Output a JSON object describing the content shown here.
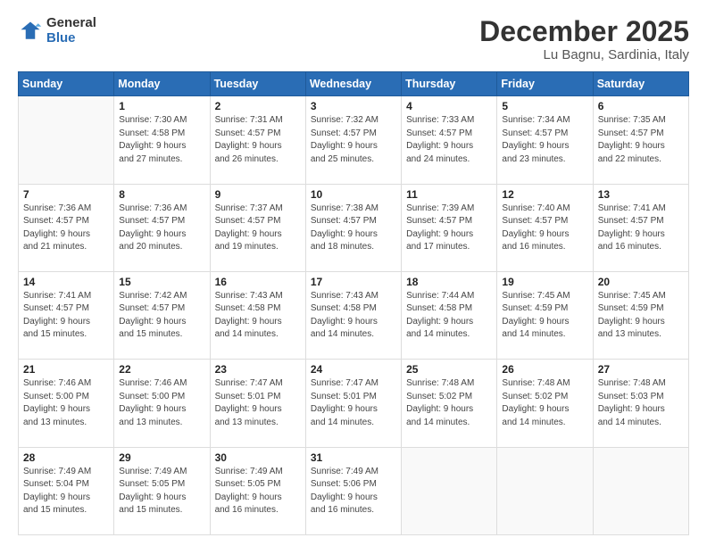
{
  "logo": {
    "general": "General",
    "blue": "Blue"
  },
  "header": {
    "title": "December 2025",
    "subtitle": "Lu Bagnu, Sardinia, Italy"
  },
  "weekdays": [
    "Sunday",
    "Monday",
    "Tuesday",
    "Wednesday",
    "Thursday",
    "Friday",
    "Saturday"
  ],
  "weeks": [
    [
      {
        "day": "",
        "info": ""
      },
      {
        "day": "1",
        "info": "Sunrise: 7:30 AM\nSunset: 4:58 PM\nDaylight: 9 hours\nand 27 minutes."
      },
      {
        "day": "2",
        "info": "Sunrise: 7:31 AM\nSunset: 4:57 PM\nDaylight: 9 hours\nand 26 minutes."
      },
      {
        "day": "3",
        "info": "Sunrise: 7:32 AM\nSunset: 4:57 PM\nDaylight: 9 hours\nand 25 minutes."
      },
      {
        "day": "4",
        "info": "Sunrise: 7:33 AM\nSunset: 4:57 PM\nDaylight: 9 hours\nand 24 minutes."
      },
      {
        "day": "5",
        "info": "Sunrise: 7:34 AM\nSunset: 4:57 PM\nDaylight: 9 hours\nand 23 minutes."
      },
      {
        "day": "6",
        "info": "Sunrise: 7:35 AM\nSunset: 4:57 PM\nDaylight: 9 hours\nand 22 minutes."
      }
    ],
    [
      {
        "day": "7",
        "info": "Sunrise: 7:36 AM\nSunset: 4:57 PM\nDaylight: 9 hours\nand 21 minutes."
      },
      {
        "day": "8",
        "info": "Sunrise: 7:36 AM\nSunset: 4:57 PM\nDaylight: 9 hours\nand 20 minutes."
      },
      {
        "day": "9",
        "info": "Sunrise: 7:37 AM\nSunset: 4:57 PM\nDaylight: 9 hours\nand 19 minutes."
      },
      {
        "day": "10",
        "info": "Sunrise: 7:38 AM\nSunset: 4:57 PM\nDaylight: 9 hours\nand 18 minutes."
      },
      {
        "day": "11",
        "info": "Sunrise: 7:39 AM\nSunset: 4:57 PM\nDaylight: 9 hours\nand 17 minutes."
      },
      {
        "day": "12",
        "info": "Sunrise: 7:40 AM\nSunset: 4:57 PM\nDaylight: 9 hours\nand 16 minutes."
      },
      {
        "day": "13",
        "info": "Sunrise: 7:41 AM\nSunset: 4:57 PM\nDaylight: 9 hours\nand 16 minutes."
      }
    ],
    [
      {
        "day": "14",
        "info": "Sunrise: 7:41 AM\nSunset: 4:57 PM\nDaylight: 9 hours\nand 15 minutes."
      },
      {
        "day": "15",
        "info": "Sunrise: 7:42 AM\nSunset: 4:57 PM\nDaylight: 9 hours\nand 15 minutes."
      },
      {
        "day": "16",
        "info": "Sunrise: 7:43 AM\nSunset: 4:58 PM\nDaylight: 9 hours\nand 14 minutes."
      },
      {
        "day": "17",
        "info": "Sunrise: 7:43 AM\nSunset: 4:58 PM\nDaylight: 9 hours\nand 14 minutes."
      },
      {
        "day": "18",
        "info": "Sunrise: 7:44 AM\nSunset: 4:58 PM\nDaylight: 9 hours\nand 14 minutes."
      },
      {
        "day": "19",
        "info": "Sunrise: 7:45 AM\nSunset: 4:59 PM\nDaylight: 9 hours\nand 14 minutes."
      },
      {
        "day": "20",
        "info": "Sunrise: 7:45 AM\nSunset: 4:59 PM\nDaylight: 9 hours\nand 13 minutes."
      }
    ],
    [
      {
        "day": "21",
        "info": "Sunrise: 7:46 AM\nSunset: 5:00 PM\nDaylight: 9 hours\nand 13 minutes."
      },
      {
        "day": "22",
        "info": "Sunrise: 7:46 AM\nSunset: 5:00 PM\nDaylight: 9 hours\nand 13 minutes."
      },
      {
        "day": "23",
        "info": "Sunrise: 7:47 AM\nSunset: 5:01 PM\nDaylight: 9 hours\nand 13 minutes."
      },
      {
        "day": "24",
        "info": "Sunrise: 7:47 AM\nSunset: 5:01 PM\nDaylight: 9 hours\nand 14 minutes."
      },
      {
        "day": "25",
        "info": "Sunrise: 7:48 AM\nSunset: 5:02 PM\nDaylight: 9 hours\nand 14 minutes."
      },
      {
        "day": "26",
        "info": "Sunrise: 7:48 AM\nSunset: 5:02 PM\nDaylight: 9 hours\nand 14 minutes."
      },
      {
        "day": "27",
        "info": "Sunrise: 7:48 AM\nSunset: 5:03 PM\nDaylight: 9 hours\nand 14 minutes."
      }
    ],
    [
      {
        "day": "28",
        "info": "Sunrise: 7:49 AM\nSunset: 5:04 PM\nDaylight: 9 hours\nand 15 minutes."
      },
      {
        "day": "29",
        "info": "Sunrise: 7:49 AM\nSunset: 5:05 PM\nDaylight: 9 hours\nand 15 minutes."
      },
      {
        "day": "30",
        "info": "Sunrise: 7:49 AM\nSunset: 5:05 PM\nDaylight: 9 hours\nand 16 minutes."
      },
      {
        "day": "31",
        "info": "Sunrise: 7:49 AM\nSunset: 5:06 PM\nDaylight: 9 hours\nand 16 minutes."
      },
      {
        "day": "",
        "info": ""
      },
      {
        "day": "",
        "info": ""
      },
      {
        "day": "",
        "info": ""
      }
    ]
  ]
}
